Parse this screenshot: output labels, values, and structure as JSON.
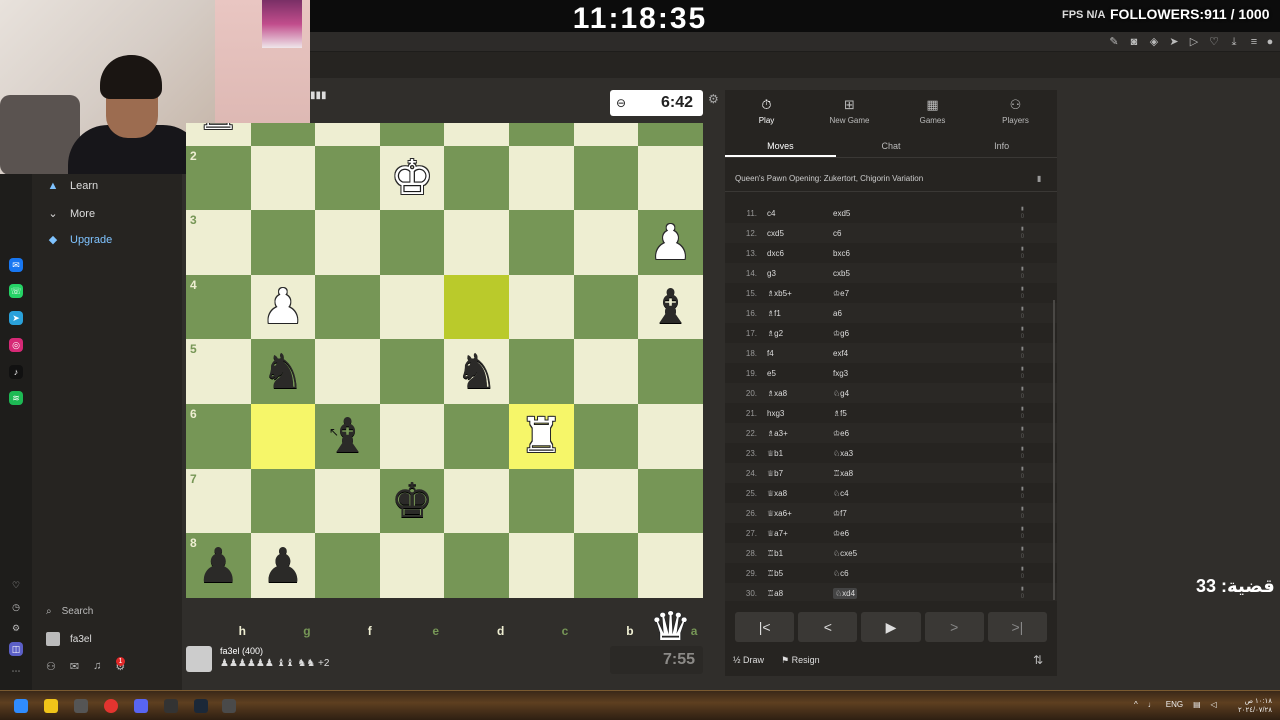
{
  "stream": {
    "clock": "11:18:35",
    "fps_label": "FPS",
    "fps_value": "N/A",
    "followers": "FOLLOWERS:911 / 1000",
    "case_label": "قضية: 33"
  },
  "sidebar": {
    "learn": "Learn",
    "more": "More",
    "upgrade": "Upgrade",
    "search": "Search",
    "username": "fa3el",
    "notif_count": "1"
  },
  "game": {
    "opponent_timer": "6:42",
    "player_timer": "7:55",
    "player_name": "fa3el (400)",
    "player_captured": "♟♟♟♟♟♟ ♝♝ ♞♞ +2",
    "ranks": [
      "2",
      "3",
      "4",
      "5",
      "6",
      "7",
      "8"
    ],
    "files": [
      "h",
      "g",
      "f",
      "e",
      "d",
      "c",
      "b",
      "a"
    ]
  },
  "panel": {
    "tabs": [
      {
        "label": "Play",
        "icon": "stopwatch-icon"
      },
      {
        "label": "New Game",
        "icon": "plus-icon"
      },
      {
        "label": "Games",
        "icon": "grid-icon"
      },
      {
        "label": "Players",
        "icon": "players-icon"
      }
    ],
    "subtabs": [
      "Moves",
      "Chat",
      "Info"
    ],
    "opening": "Queen's Pawn Opening: Zukertort, Chigorin Variation",
    "moves": [
      {
        "n": "11.",
        "w": "c4",
        "b": "exd5"
      },
      {
        "n": "12.",
        "w": "cxd5",
        "b": "c6"
      },
      {
        "n": "13.",
        "w": "dxc6",
        "b": "bxc6"
      },
      {
        "n": "14.",
        "w": "g3",
        "b": "cxb5"
      },
      {
        "n": "15.",
        "w": "♗xb5+",
        "b": "♔e7"
      },
      {
        "n": "16.",
        "w": "♗f1",
        "b": "a6"
      },
      {
        "n": "17.",
        "w": "♗g2",
        "b": "♔g6"
      },
      {
        "n": "18.",
        "w": "f4",
        "b": "exf4"
      },
      {
        "n": "19.",
        "w": "e5",
        "b": "fxg3"
      },
      {
        "n": "20.",
        "w": "♗xa8",
        "b": "♘g4"
      },
      {
        "n": "21.",
        "w": "hxg3",
        "b": "♗f5"
      },
      {
        "n": "22.",
        "w": "♗a3+",
        "b": "♔e6"
      },
      {
        "n": "23.",
        "w": "♕b1",
        "b": "♘xa3"
      },
      {
        "n": "24.",
        "w": "♕b7",
        "b": "♖xa8"
      },
      {
        "n": "25.",
        "w": "♕xa8",
        "b": "♘c4"
      },
      {
        "n": "26.",
        "w": "♕xa6+",
        "b": "♔f7"
      },
      {
        "n": "27.",
        "w": "♕a7+",
        "b": "♔e6"
      },
      {
        "n": "28.",
        "w": "♖b1",
        "b": "♘cxe5"
      },
      {
        "n": "29.",
        "w": "♖b5",
        "b": "♘c6"
      },
      {
        "n": "30.",
        "w": "♖a8",
        "b": "♘xd4"
      }
    ],
    "draw": "Draw",
    "resign": "Resign",
    "draw_prefix": "½"
  },
  "taskbar": {
    "lang": "ENG",
    "time": "١٠:١٨ ص",
    "date": "٢٠٢٤/٠٧/٢٨"
  }
}
